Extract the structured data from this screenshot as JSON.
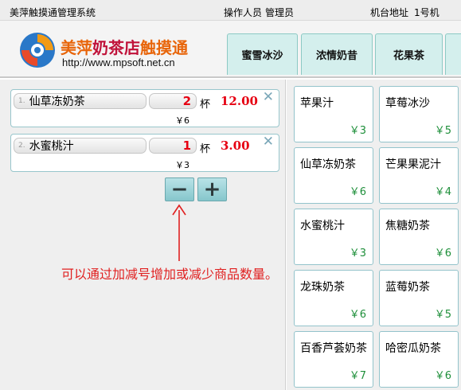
{
  "topbar": {
    "system_name": "美萍触摸通管理系统",
    "operator_label": "操作人员",
    "operator_value": "管理员",
    "terminal_label": "机台地址",
    "terminal_value": "1号机"
  },
  "brand": {
    "name_part1": "美萍",
    "name_part2": "奶茶店",
    "name_part3": "触摸通",
    "url": "http://www.mpsoft.net.cn"
  },
  "tabs": [
    "蜜雪冰沙",
    "浓情奶昔",
    "花果茶"
  ],
  "order": {
    "unit_label": "杯",
    "items": [
      {
        "index": "1.",
        "name": "仙草冻奶茶",
        "qty": "2",
        "subtotal": "12.00",
        "unit_price": "￥6"
      },
      {
        "index": "2.",
        "name": "水蜜桃汁",
        "qty": "1",
        "subtotal": "3.00",
        "unit_price": "￥3"
      }
    ]
  },
  "stepper": {
    "minus": "−",
    "plus": "+"
  },
  "hint": "可以通过加减号增加或减少商品数量。",
  "products": [
    {
      "name": "苹果汁",
      "price": "￥3"
    },
    {
      "name": "草莓冰沙",
      "price": "￥5"
    },
    {
      "name": "仙草冻奶茶",
      "price": "￥6"
    },
    {
      "name": "芒果果泥汁",
      "price": "￥4"
    },
    {
      "name": "水蜜桃汁",
      "price": "￥3"
    },
    {
      "name": "焦糖奶茶",
      "price": "￥6"
    },
    {
      "name": "龙珠奶茶",
      "price": "￥6"
    },
    {
      "name": "蓝莓奶茶",
      "price": "￥5"
    },
    {
      "name": "百香芦荟奶茶",
      "price": "￥7"
    },
    {
      "name": "哈密瓜奶茶",
      "price": "￥6"
    }
  ],
  "colors": {
    "accent_red": "#e60012",
    "border_teal": "#93c3cb",
    "price_green": "#1e8f3a",
    "brand_orange": "#e8650a"
  }
}
